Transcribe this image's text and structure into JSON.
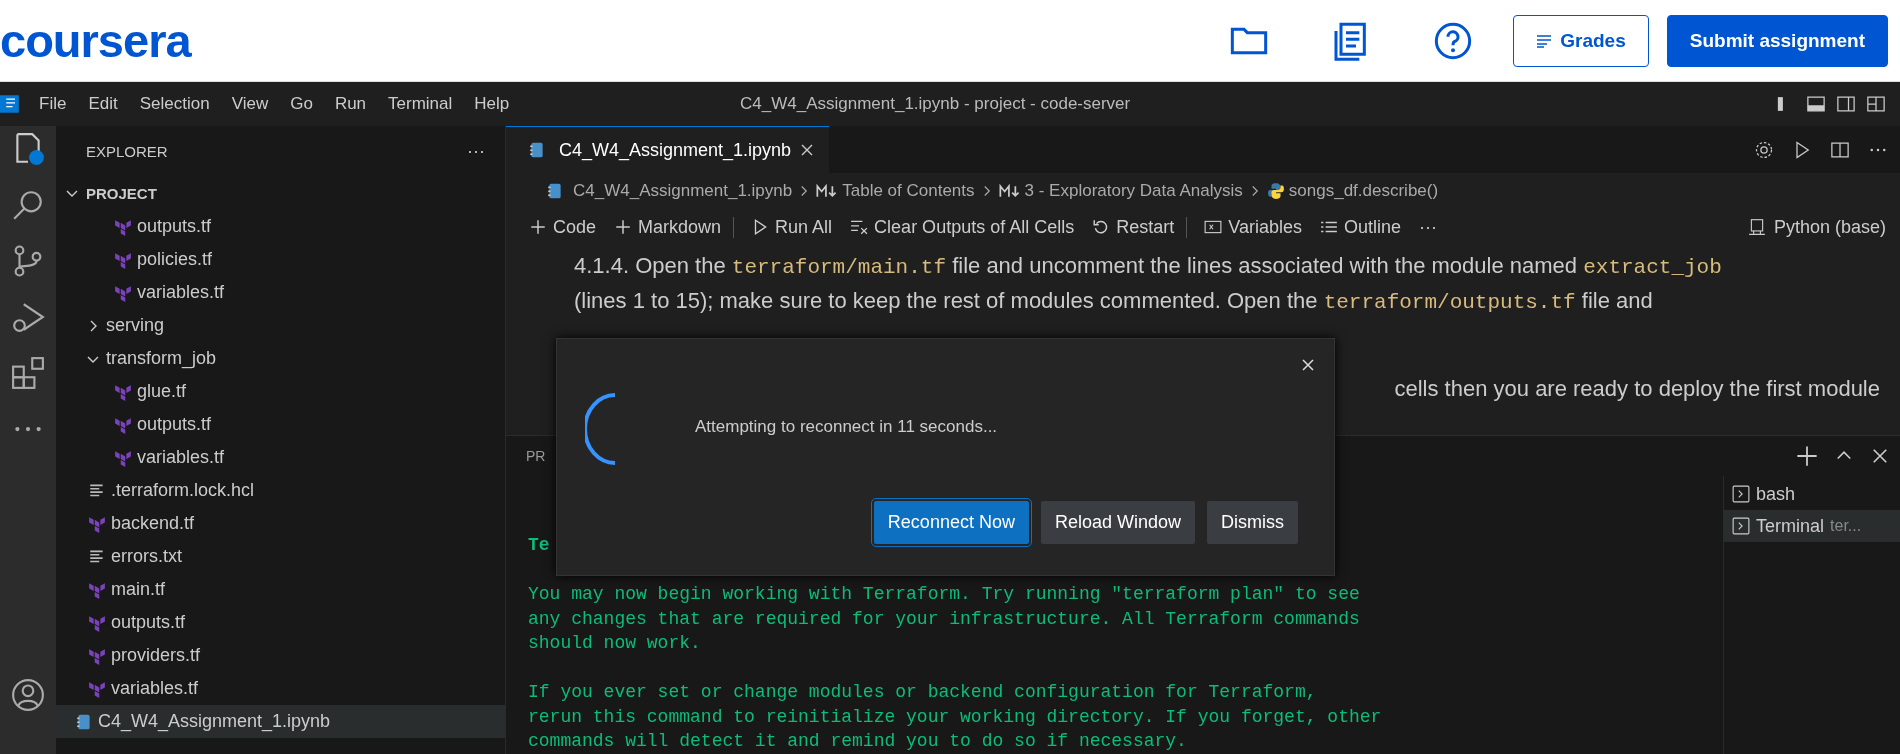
{
  "site_header": {
    "logo": "coursera",
    "buttons": [
      {
        "label": "Grades",
        "kind": "outline"
      },
      {
        "label": "Submit assignment",
        "kind": "primary"
      }
    ]
  },
  "title_bar": {
    "menu": [
      "File",
      "Edit",
      "Selection",
      "View",
      "Go",
      "Run",
      "Terminal",
      "Help"
    ],
    "title": "C4_W4_Assignment_1.ipynb - project - code-server"
  },
  "sidebar": {
    "title": "EXPLORER",
    "more": "···",
    "section": {
      "label": "PROJECT",
      "expanded": true
    },
    "tree": [
      {
        "children": [
          {
            "children": [
              {
                "children": [
                  {
                    "name": "outputs.tf",
                    "kind": "terraform",
                    "selected": false
                  },
                  {
                    "name": "policies.tf",
                    "kind": "terraform",
                    "selected": false
                  },
                  {
                    "name": "variables.tf",
                    "kind": "terraform",
                    "selected": false
                  }
                ]
              },
              {
                "name": "serving",
                "kind": "folder",
                "expanded": false,
                "selected": false
              },
              {
                "name": "transform_job",
                "kind": "folder",
                "expanded": true,
                "selected": false,
                "children": [
                  {
                    "name": "glue.tf",
                    "kind": "terraform",
                    "selected": false
                  },
                  {
                    "name": "outputs.tf",
                    "kind": "terraform",
                    "selected": false
                  },
                  {
                    "name": "variables.tf",
                    "kind": "terraform",
                    "selected": false
                  }
                ]
              }
            ]
          },
          {
            "name": ".terraform.lock.hcl",
            "kind": "text",
            "selected": false
          },
          {
            "name": "backend.tf",
            "kind": "terraform",
            "selected": false
          },
          {
            "name": "errors.txt",
            "kind": "text",
            "selected": false
          },
          {
            "name": "main.tf",
            "kind": "terraform",
            "selected": false
          },
          {
            "name": "outputs.tf",
            "kind": "terraform",
            "selected": false
          },
          {
            "name": "providers.tf",
            "kind": "terraform",
            "selected": false
          },
          {
            "name": "variables.tf",
            "kind": "terraform",
            "selected": false
          }
        ]
      },
      {
        "name": "C4_W4_Assignment_1.ipynb",
        "kind": "notebook",
        "selected": true
      }
    ]
  },
  "editor": {
    "tabs": [
      {
        "label": "C4_W4_Assignment_1.ipynb",
        "selected": true
      }
    ],
    "breadcrumbs": [
      {
        "label": "C4_W4_Assignment_1.ipynb",
        "kind": "notebook"
      },
      {
        "label": "Table of Contents",
        "kind": "markdown"
      },
      {
        "label": "3 - Exploratory Data Analysis",
        "kind": "markdown"
      },
      {
        "label": "songs_df.describe()",
        "kind": "python"
      }
    ],
    "toolbar": [
      {
        "label": "Code",
        "kind": "add",
        "divider_after": false
      },
      {
        "label": "Markdown",
        "kind": "add",
        "divider_after": true
      },
      {
        "label": "Run All",
        "kind": "run",
        "divider_after": false
      },
      {
        "label": "Clear Outputs of All Cells",
        "kind": "clear",
        "divider_after": false
      },
      {
        "label": "Restart",
        "kind": "restart",
        "divider_after": true
      },
      {
        "label": "Variables",
        "kind": "variables",
        "divider_after": false
      },
      {
        "label": "Outline",
        "kind": "outline",
        "divider_after": false
      },
      {
        "label": "···",
        "kind": "more",
        "divider_after": false
      }
    ],
    "kernel": "Python (base)",
    "paragraph": [
      {
        "text": "4.1.4. Open the ",
        "kind": "text"
      },
      {
        "text": "terraform/main.tf",
        "kind": "code"
      },
      {
        "text": " file and uncomment the lines associated with the module named ",
        "kind": "text"
      },
      {
        "text": "extract_job",
        "kind": "code"
      },
      {
        "text": " (lines 1 to 15); make sure to keep the rest of modules commented. Open the ",
        "kind": "text"
      },
      {
        "text": "terraform/outputs.tf",
        "kind": "code"
      },
      {
        "text": " file and",
        "kind": "text"
      }
    ],
    "paragraph_2_end": "cells then you are ready to deploy the first module"
  },
  "panel": {
    "tab": "PR",
    "terminal": [
      {
        "bold": true,
        "lines": [
          "Te"
        ]
      },
      {
        "bold": false,
        "lines": [
          "You may now begin working with Terraform. Try running \"terraform plan\" to see",
          "any changes that are required for your infrastructure. All Terraform commands",
          "should now work."
        ]
      },
      {
        "bold": false,
        "lines": [
          "If you ever set or change modules or backend configuration for Terraform,",
          "rerun this command to reinitialize your working directory. If you forget, other",
          "commands will detect it and remind you to do so if necessary."
        ]
      }
    ],
    "terminals": [
      {
        "label": "bash",
        "selected": false
      },
      {
        "label": "Terminal",
        "detail": "ter...",
        "selected": true
      }
    ]
  },
  "dialog": {
    "message": "Attempting to reconnect in 11 seconds...",
    "buttons": [
      {
        "label": "Reconnect Now",
        "kind": "primary"
      },
      {
        "label": "Reload Window",
        "kind": "secondary"
      },
      {
        "label": "Dismiss",
        "kind": "secondary"
      }
    ]
  }
}
